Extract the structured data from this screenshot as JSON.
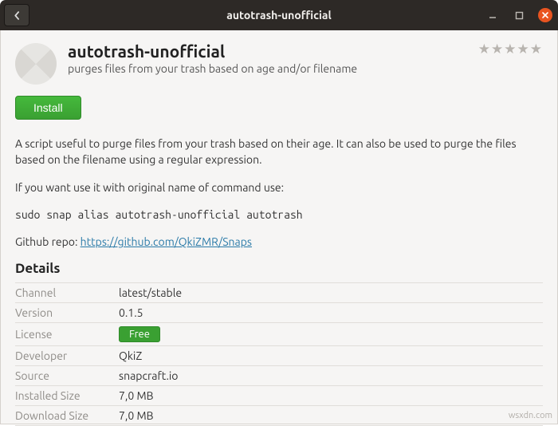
{
  "window": {
    "title": "autotrash-unofficial"
  },
  "app": {
    "name": "autotrash-unofficial",
    "subtitle": "purges files from your trash based on age and/or filename"
  },
  "actions": {
    "install_label": "Install"
  },
  "description": {
    "p1": "A script useful to purge files from your trash based on their age. It can also be used to purge the files based on the filename using a regular expression.",
    "p2": "If you want use it with original name of command use:",
    "command": "sudo snap alias autotrash-unofficial autotrash",
    "repo_prefix": "Github repo: ",
    "repo_url_text": "https://github.com/QkiZMR/Snaps"
  },
  "details": {
    "heading": "Details",
    "channel": {
      "label": "Channel",
      "value": "latest/stable"
    },
    "version": {
      "label": "Version",
      "value": "0.1.5"
    },
    "license": {
      "label": "License",
      "value": "Free"
    },
    "developer": {
      "label": "Developer",
      "value": "QkiZ"
    },
    "source": {
      "label": "Source",
      "value": "snapcraft.io"
    },
    "installed_size": {
      "label": "Installed Size",
      "value": "7,0 MB"
    },
    "download_size": {
      "label": "Download Size",
      "value": "7,0 MB"
    }
  },
  "watermark": "wsxdn.com"
}
